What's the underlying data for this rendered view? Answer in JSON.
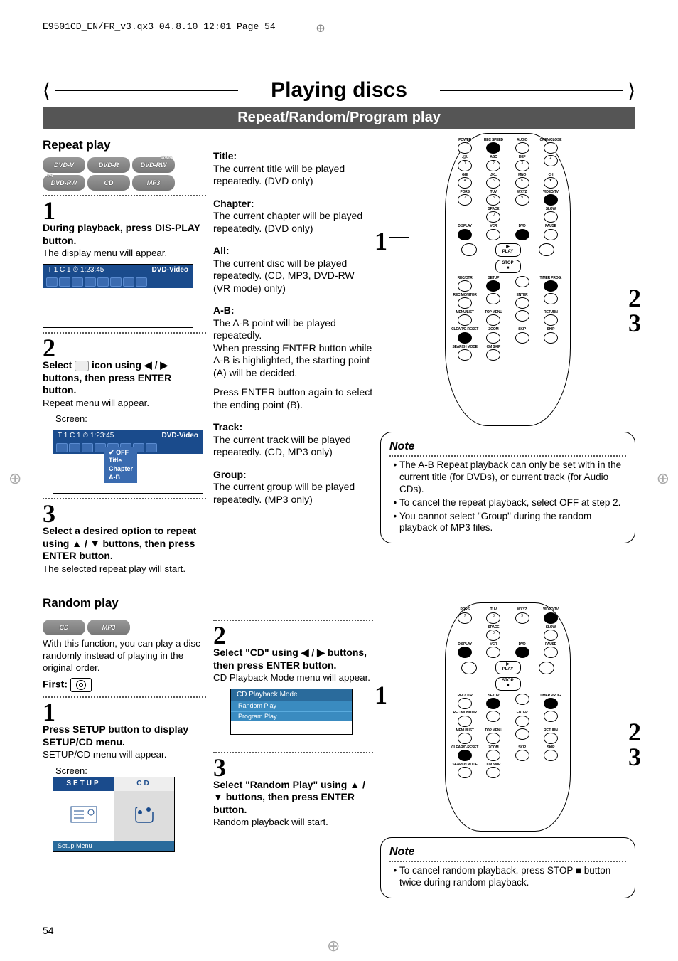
{
  "print_header": "E9501CD_EN/FR_v3.qx3  04.8.10  12:01  Page 54",
  "page_title": "Playing discs",
  "sub_header": "Repeat/Random/Program play",
  "page_number": "54",
  "repeat": {
    "heading": "Repeat play",
    "badges": [
      "DVD-V",
      "DVD-R",
      "DVD-RW",
      "DVD-RW",
      "CD",
      "MP3"
    ],
    "badge_sup": [
      "",
      "",
      "Video",
      "VR",
      "",
      ""
    ],
    "step1": {
      "num": "1",
      "bold": "During playback, press DIS-PLAY button.",
      "body": "The display menu will appear.",
      "screen": {
        "title_row": "T   1  C   1 ⏱   1:23:45",
        "right": "DVD-Video"
      }
    },
    "step2": {
      "num": "2",
      "pre": "Select ",
      "mid": " icon using ◀ / ▶ buttons, then press ENTER button.",
      "body": "Repeat menu will appear.",
      "screen_label": "Screen:",
      "screen": {
        "title_row": "T   1  C   1 ⏱   1:23:45",
        "right": "DVD-Video",
        "menu": [
          "OFF",
          "Title",
          "Chapter",
          "A-B"
        ],
        "check": "✔"
      }
    },
    "step3": {
      "num": "3",
      "bold": "Select a desired option to repeat using ▲ / ▼ buttons, then press ENTER button.",
      "body": "The selected repeat play will start."
    },
    "modes": [
      {
        "name": "Title:",
        "desc": "The current title will be played repeatedly. (DVD only)"
      },
      {
        "name": "Chapter:",
        "desc": "The current chapter will be played repeatedly. (DVD only)"
      },
      {
        "name": "All:",
        "desc": "The current disc will be played repeatedly. (CD, MP3, DVD-RW (VR mode) only)"
      },
      {
        "name": "A-B:",
        "desc": "The A-B point will be played repeatedly.\nWhen pressing ENTER button while A-B is highlighted, the starting point (A) will be decided.",
        "extra": "Press ENTER button again to select the ending point (B)."
      },
      {
        "name": "Track:",
        "desc": "The current track will be played repeatedly. (CD, MP3 only)"
      },
      {
        "name": "Group:",
        "desc": "The current group will be played repeatedly. (MP3 only)"
      }
    ],
    "note": {
      "title": "Note",
      "items": [
        "The A-B Repeat playback can only be set with in the current title (for DVDs), or current track (for Audio CDs).",
        "To cancel the repeat playback, select OFF at step 2.",
        "You cannot select \"Group\" during the random playback of MP3 files."
      ]
    },
    "callouts": [
      "1",
      "2",
      "3"
    ]
  },
  "random": {
    "heading": "Random play",
    "badges": [
      "CD",
      "MP3"
    ],
    "intro": "With this function, you can play a disc randomly instead of playing in the original order.",
    "first_label": "First:",
    "step1": {
      "num": "1",
      "bold": "Press SETUP button to display SETUP/CD menu.",
      "body": "SETUP/CD menu will appear.",
      "screen_label": "Screen:",
      "tabs": [
        "SETUP",
        "CD"
      ],
      "footer": "Setup Menu"
    },
    "step2": {
      "num": "2",
      "bold": "Select \"CD\" using ◀ / ▶ buttons, then press ENTER button.",
      "body": "CD Playback Mode menu will appear.",
      "menu_header": "CD Playback Mode",
      "menu_items": [
        "Random Play",
        "Program Play"
      ]
    },
    "step3": {
      "num": "3",
      "bold": "Select \"Random Play\" using ▲ / ▼ buttons, then press ENTER button.",
      "body": "Random playback will start."
    },
    "note": {
      "title": "Note",
      "items": [
        "To cancel random playback, press STOP ■ button twice during random playback."
      ]
    },
    "callouts": [
      "1",
      "2",
      "3"
    ]
  },
  "remote": {
    "row1": [
      "POWER",
      "REC SPEED",
      "AUDIO",
      "OPEN/CLOSE"
    ],
    "row2": [
      ".@/:",
      "ABC",
      "DEF",
      ""
    ],
    "row2n": [
      "1",
      "2",
      "3",
      "+"
    ],
    "row3": [
      "GHI",
      "JKL",
      "MNO",
      "CH"
    ],
    "row3n": [
      "4",
      "5",
      "6",
      "▼"
    ],
    "row4": [
      "PQRS",
      "TUV",
      "WXYZ",
      "VIDEO/TV"
    ],
    "row4n": [
      "7",
      "8",
      "9",
      ""
    ],
    "row5": [
      "",
      "SPACE",
      "",
      "SLOW"
    ],
    "row5n": [
      "",
      "0",
      "",
      ""
    ],
    "row6": [
      "DISPLAY",
      "VCR",
      "DVD",
      "PAUSE"
    ],
    "play": "PLAY",
    "stop": "STOP",
    "row7": [
      "REC/OTR",
      "SETUP",
      "",
      "TIMER PROG."
    ],
    "row8": [
      "REC MONITOR",
      "",
      "ENTER",
      ""
    ],
    "row9": [
      "MENU/LIST",
      "TOP MENU",
      "",
      "RETURN"
    ],
    "row10": [
      "CLEAR/C-RESET",
      "ZOOM",
      "SKIP",
      "SKIP"
    ],
    "row11": [
      "SEARCH MODE",
      "CM SKIP",
      "",
      ""
    ]
  }
}
